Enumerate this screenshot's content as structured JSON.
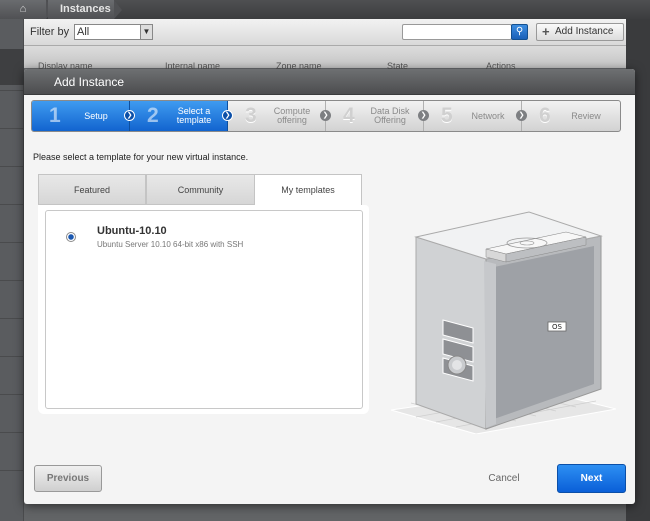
{
  "background": {
    "breadcrumb": {
      "home_icon": "home-icon",
      "current": "Instances"
    },
    "filter": {
      "label": "Filter by",
      "value": "All"
    },
    "search": {
      "placeholder": ""
    },
    "add_button_label": "Add Instance",
    "grid_columns": [
      "Display name",
      "Internal name",
      "Zone name",
      "State",
      "Actions"
    ]
  },
  "dialog": {
    "title": "Add Instance",
    "steps": [
      {
        "num": "1",
        "label": "Setup",
        "state": "completed"
      },
      {
        "num": "2",
        "label_line1": "Select a",
        "label_line2": "template",
        "state": "current"
      },
      {
        "num": "3",
        "label_line1": "Compute",
        "label_line2": "offering",
        "state": "pending"
      },
      {
        "num": "4",
        "label_line1": "Data Disk",
        "label_line2": "Offering",
        "state": "pending"
      },
      {
        "num": "5",
        "label": "Network",
        "state": "pending"
      },
      {
        "num": "6",
        "label": "Review",
        "state": "pending"
      }
    ],
    "instruction": "Please select a template for your new virtual instance.",
    "tabs": [
      {
        "label": "Featured",
        "selected": false
      },
      {
        "label": "Community",
        "selected": false
      },
      {
        "label": "My templates",
        "selected": true
      }
    ],
    "templates": [
      {
        "name": "Ubuntu-10.10",
        "description": "Ubuntu Server 10.10 64-bit x86 with SSH",
        "selected": true
      }
    ],
    "illustration": {
      "label": "OS"
    },
    "buttons": {
      "previous": "Previous",
      "cancel": "Cancel",
      "next": "Next"
    }
  },
  "colors": {
    "accent": "#1264cf",
    "title_bar": "#5a5b5d"
  }
}
